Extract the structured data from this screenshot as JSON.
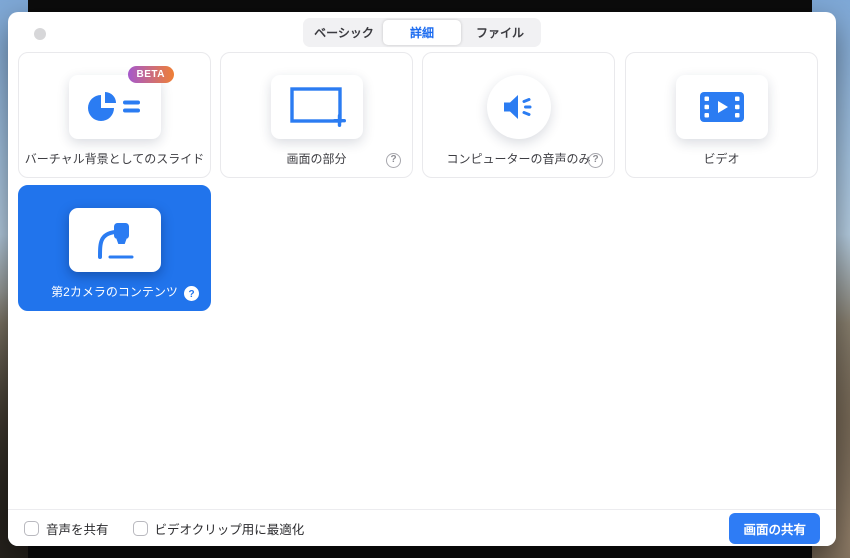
{
  "window": {
    "control": "inactive-traffic-light",
    "tabs": [
      {
        "label": "ベーシック",
        "selected": false
      },
      {
        "label": "詳細",
        "selected": true
      },
      {
        "label": "ファイル",
        "selected": false
      }
    ],
    "cards": [
      {
        "label": "バーチャル背景としてのスライド",
        "badge": "BETA",
        "icon": "pie-chart-slides-icon",
        "has_help": false,
        "selected": false
      },
      {
        "label": "画面の部分",
        "icon": "screen-portion-icon",
        "has_help": true,
        "selected": false
      },
      {
        "label": "コンピューターの音声のみ",
        "icon": "speaker-icon",
        "has_help": true,
        "selected": false
      },
      {
        "label": "ビデオ",
        "icon": "film-video-icon",
        "has_help": false,
        "selected": false
      },
      {
        "label": "第2カメラのコンテンツ",
        "icon": "document-camera-icon",
        "has_help": true,
        "selected": true
      }
    ],
    "help_glyph": "?",
    "footer": {
      "checkboxes": [
        {
          "label": "音声を共有",
          "checked": false
        },
        {
          "label": "ビデオクリップ用に最適化",
          "checked": false
        }
      ],
      "share_button_label": "画面の共有"
    },
    "colors": {
      "accent_blue": "#2b7cf2",
      "selected_card": "#2174ec",
      "button_blue": "#2e7cf5",
      "badge_gradient": [
        "#a558cc",
        "#ef7f35"
      ],
      "backdrop": "#0c0c0c"
    }
  }
}
